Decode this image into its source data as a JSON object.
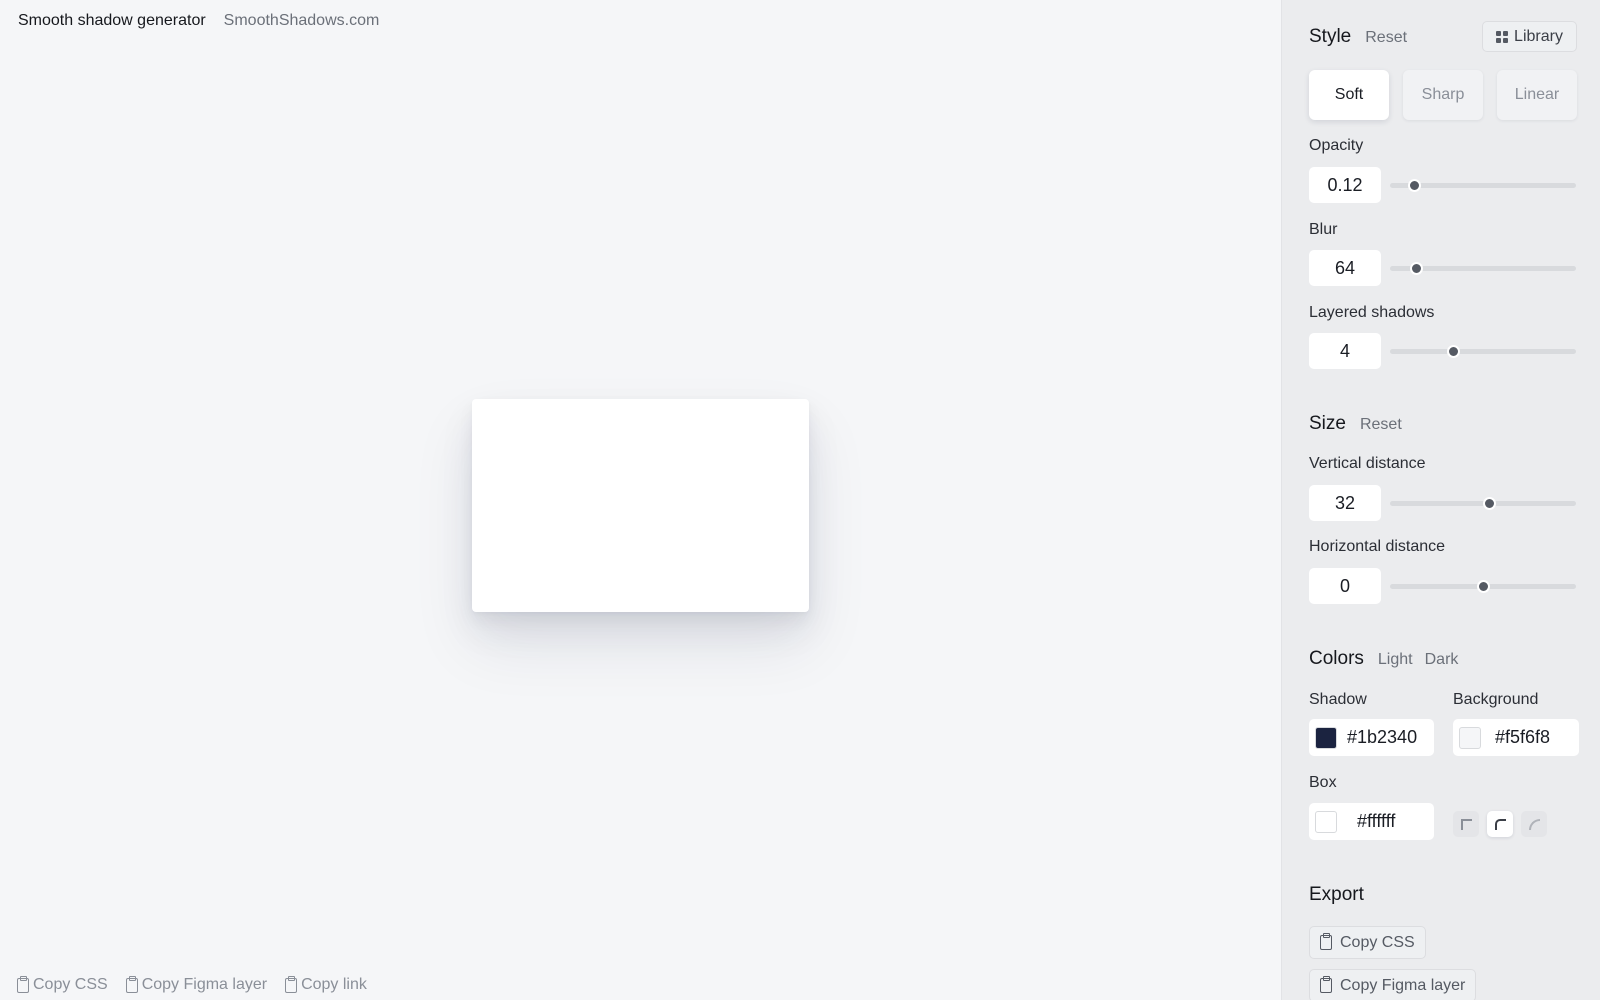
{
  "header": {
    "app_title": "Smooth shadow generator",
    "site_link": "SmoothShadows.com"
  },
  "bottom_bar": {
    "copy_css": "Copy CSS",
    "copy_figma": "Copy Figma layer",
    "copy_link": "Copy link"
  },
  "style": {
    "title": "Style",
    "reset": "Reset",
    "library": "Library",
    "presets": [
      {
        "label": "Soft",
        "active": true
      },
      {
        "label": "Sharp",
        "active": false
      },
      {
        "label": "Linear",
        "active": false
      }
    ],
    "opacity": {
      "label": "Opacity",
      "value": "0.12",
      "slider_fraction": 0.13
    },
    "blur": {
      "label": "Blur",
      "value": "64",
      "slider_fraction": 0.14
    },
    "layers": {
      "label": "Layered shadows",
      "value": "4",
      "slider_fraction": 0.34
    }
  },
  "size": {
    "title": "Size",
    "reset": "Reset",
    "vertical": {
      "label": "Vertical distance",
      "value": "32",
      "slider_fraction": 0.53
    },
    "horizontal": {
      "label": "Horizontal distance",
      "value": "0",
      "slider_fraction": 0.5
    }
  },
  "colors": {
    "title": "Colors",
    "light": "Light",
    "dark": "Dark",
    "shadow": {
      "label": "Shadow",
      "value": "#1b2340",
      "color": "#1b2340"
    },
    "background": {
      "label": "Background",
      "value": "#f5f6f8",
      "color": "#f5f6f8"
    },
    "box": {
      "label": "Box",
      "value": "#ffffff",
      "color": "#ffffff"
    },
    "corner_options": [
      "square-corner-icon",
      "rounded-corner-icon",
      "round-corner-icon"
    ],
    "corner_active": 1
  },
  "export": {
    "title": "Export",
    "copy_css": "Copy CSS",
    "copy_figma": "Copy Figma layer"
  }
}
